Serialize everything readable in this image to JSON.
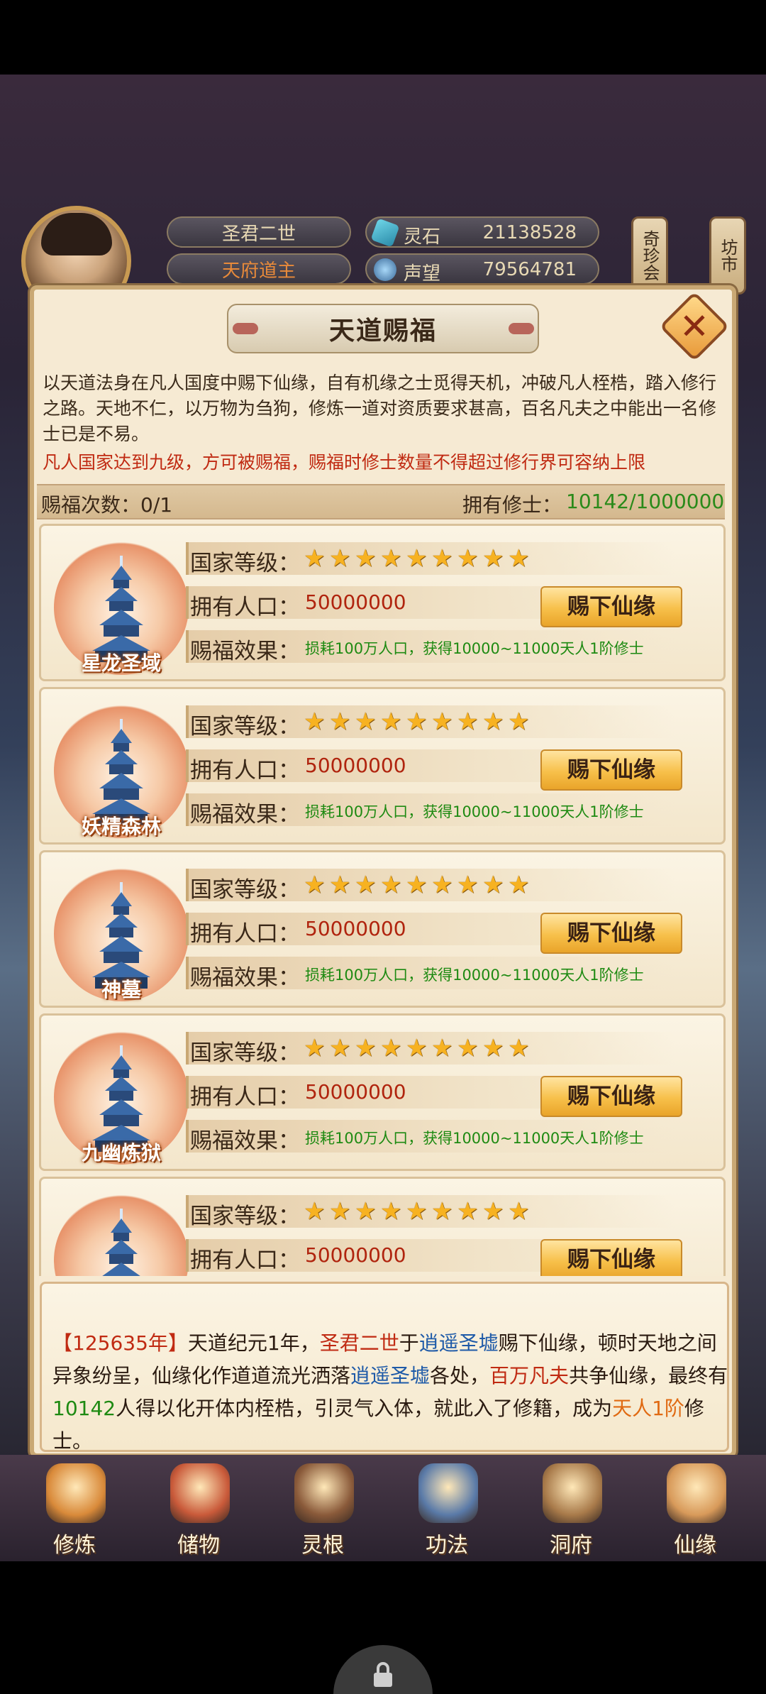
{
  "hud": {
    "name": "圣君二世",
    "rank": "天府道主",
    "resources": [
      {
        "icon": "spirit-stone-icon",
        "label": "灵石",
        "value": "21138528"
      },
      {
        "icon": "reputation-icon",
        "label": "声望",
        "value": "79564781"
      }
    ],
    "side_tags": [
      "奇珍会",
      "坊市"
    ]
  },
  "dialog": {
    "title": "天道赐福",
    "description": "以天道法身在凡人国度中赐下仙缘，自有机缘之士觅得天机，冲破凡人桎梏，踏入修行之路。天地不仁，以万物为刍狗，修炼一道对资质要求甚高，百名凡夫之中能出一名修士已是不易。",
    "warning": "凡人国家达到九级，方可被赐福，赐福时修士数量不得超过修行界可容纳上限",
    "bless_count_label": "赐福次数：",
    "bless_count_value": "0/1",
    "cultivators_label": "拥有修士：",
    "cultivators_value": "10142/1000000"
  },
  "labels": {
    "level": "国家等级：",
    "population": "拥有人口：",
    "effect": "赐福效果：",
    "button": "赐下仙缘"
  },
  "nations": [
    {
      "name": "星龙圣域",
      "stars": 9,
      "population": "50000000",
      "effect": "损耗100万人口，获得10000~11000天人1阶修士"
    },
    {
      "name": "妖精森林",
      "stars": 9,
      "population": "50000000",
      "effect": "损耗100万人口，获得10000~11000天人1阶修士"
    },
    {
      "name": "神墓",
      "stars": 9,
      "population": "50000000",
      "effect": "损耗100万人口，获得10000~11000天人1阶修士"
    },
    {
      "name": "九幽炼狱",
      "stars": 9,
      "population": "50000000",
      "effect": "损耗100万人口，获得10000~11000天人1阶修士"
    },
    {
      "name": "",
      "stars": 9,
      "population": "50000000",
      "effect": ""
    }
  ],
  "log": {
    "year": "【125635年】",
    "era": "天道纪元1年，",
    "who": "圣君二世",
    "t1": "于",
    "place1": "逍遥圣墟",
    "t2": "赐下仙缘，顿时天地之间异象纷呈，仙缘化作道道流光洒落",
    "place2": "逍遥圣墟",
    "t3": "各处，",
    "million": "百万凡夫",
    "t4": "共争仙缘，最终有",
    "count": "10142",
    "t5": "人得以化开体内桎梏，引灵气入体，就此入了修籍，成为",
    "rank": "天人1阶",
    "t6": "修士。"
  },
  "bottom_tabs": [
    "修炼",
    "储物",
    "灵根",
    "功法",
    "洞府",
    "仙缘"
  ],
  "colors": {
    "panel_bg": "#f6ead3",
    "accent_red": "#c02a12",
    "accent_green": "#1e8a12",
    "star": "#f7b221",
    "button": "#f7c04a"
  }
}
